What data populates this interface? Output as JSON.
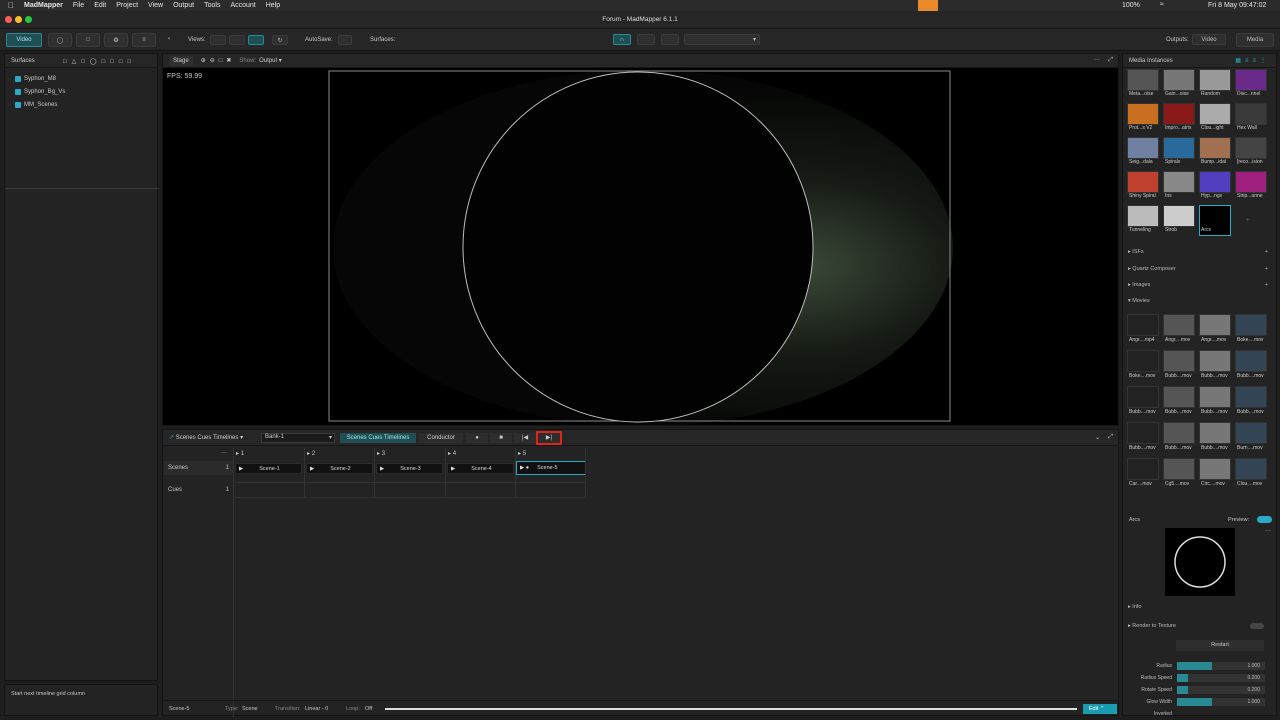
{
  "menubar": {
    "app": "MadMapper",
    "items": [
      "File",
      "Edit",
      "Project",
      "View",
      "Output",
      "Tools",
      "Account",
      "Help"
    ],
    "battery": "100%",
    "clock": "Fri 8 May  09:47:02"
  },
  "window": {
    "title": "Forum - MadMapper 6.1.1"
  },
  "toolbar": {
    "video_tab": "Video",
    "views_label": "Views:",
    "autosave_label": "AutoSave:",
    "surfaces_label": "Surfaces:",
    "outputs_label": "Outputs:",
    "outputs_value": "Video",
    "media_label": "Media"
  },
  "surfaces": {
    "title": "Surfaces",
    "items": [
      "Syphon_M8",
      "Syphon_Bg_Vs",
      "MM_Scenes"
    ],
    "status": "Start next timeline grid column"
  },
  "stage": {
    "tab": "Stage",
    "show_label": "Show:",
    "show_value": "Output",
    "fps": "FPS: 59.99"
  },
  "timeline": {
    "mode": "Scenes Cues Timelines",
    "bank": "Bank-1",
    "tab_active": "Scenes Cues Timelines",
    "tab_other": "Conductor",
    "more": "···",
    "columns": [
      "1",
      "2",
      "3",
      "4",
      "5"
    ],
    "rows": [
      {
        "label": "Scenes",
        "num": "1"
      },
      {
        "label": "Cues",
        "num": "1"
      }
    ],
    "scenes": [
      "Scene-1",
      "Scene-2",
      "Scene-3",
      "Scene-4",
      "Scene-5"
    ]
  },
  "footer": {
    "name": "Scene-5",
    "type_label": "Type:",
    "type_value": "Scene",
    "transition_label": "Transition:",
    "transition_value": "Linear - 0",
    "loop_label": "Loop:",
    "loop_value": "Off",
    "edit": "Edit"
  },
  "media": {
    "title": "Media Instances",
    "instances": [
      "Meta...oise",
      "Gain...oise",
      "Random",
      "Disc...nnel",
      "Prot...s V2",
      "Impro...atrix",
      "Clou...ight",
      "Hex Wall",
      "Seig...dala",
      "Spirals",
      "Bump...idal",
      "[reco...ision",
      "Shiny Spiral",
      "Iris",
      "Hyp...ngs",
      "Strip...unne",
      "Tunneling",
      "Strob",
      "Arcs"
    ],
    "sections": [
      "ISFs",
      "Quartz Composer",
      "Images",
      "Movies"
    ],
    "movies": [
      "Angr....mp4",
      "Angr....mov",
      "Angr....mov",
      "Boke....mov",
      "Boke....mov",
      "Bubb....mov",
      "Bubb....mov",
      "Bubb....mov",
      "Bubb....mov",
      "Bubb....mov",
      "Bubb....mov",
      "Bubb....mov",
      "Bubb....mov",
      "Bubb....mov",
      "Bubb....mov",
      "Burn....mov",
      "Car....mov",
      "Cg5....mov",
      "Circ....mov",
      "Clou....mov"
    ],
    "selected": "Arcs",
    "preview_label": "Preview:",
    "info": "Info",
    "render": "Render to Texture",
    "restart": "Restart",
    "params": [
      {
        "name": "Radius",
        "value": "1.000",
        "fill": 0.4
      },
      {
        "name": "Radius Speed",
        "value": "0.200",
        "fill": 0.13
      },
      {
        "name": "Rotate Speed",
        "value": "0.200",
        "fill": 0.13
      },
      {
        "name": "Glow Width",
        "value": "1.000",
        "fill": 0.4
      },
      {
        "name": "Inverted",
        "value": "",
        "fill": 0
      }
    ]
  },
  "colors": {
    "accent": "#2a8a94",
    "highlight": "#e0241b"
  }
}
